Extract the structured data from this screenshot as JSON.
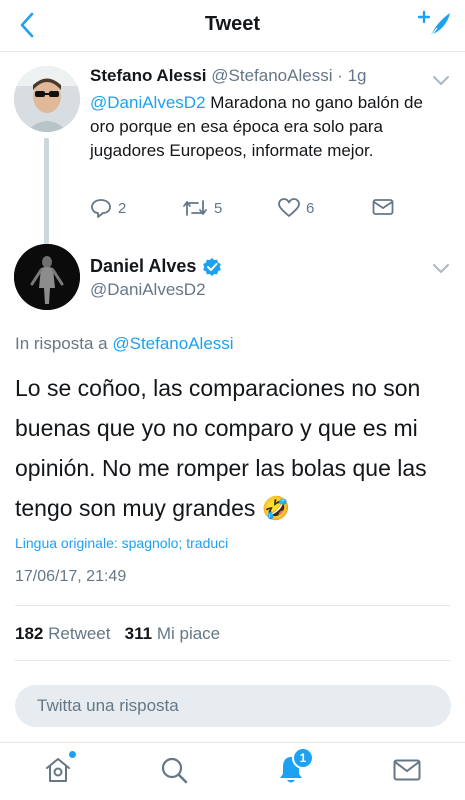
{
  "header": {
    "title": "Tweet",
    "back_icon": "chevron-left-icon",
    "compose_icon": "compose-tweet-icon",
    "accent": "#1da1f2"
  },
  "parent_tweet": {
    "name": "Stefano Alessi",
    "handle": "@StefanoAlessi",
    "time": "· 1g",
    "mention": "@DaniAlvesD2",
    "text": "Maradona no gano balón de oro porque en esa época era solo para jugadores Europeos, informate mejor.",
    "replies": "2",
    "retweets": "5",
    "likes": "6"
  },
  "main_tweet": {
    "name": "Daniel Alves",
    "handle": "@DaniAlvesD2",
    "reply_prefix": "In risposta a",
    "reply_handle": "@StefanoAlessi",
    "text": "Lo se coñoo, las comparaciones no son buenas que yo no comparo y que es mi opinión. No me romper las bolas que las tengo  son muy grandes 🤣",
    "language_note": "Lingua originale: spagnolo; traduci",
    "timestamp": "17/06/17, 21:49",
    "retweet_count": "182",
    "retweet_label": "Retweet",
    "like_count": "311",
    "like_label": "Mi piace"
  },
  "reply_bar": {
    "placeholder": "Twitta una risposta"
  },
  "tabbar": {
    "notifications_badge": "1"
  }
}
